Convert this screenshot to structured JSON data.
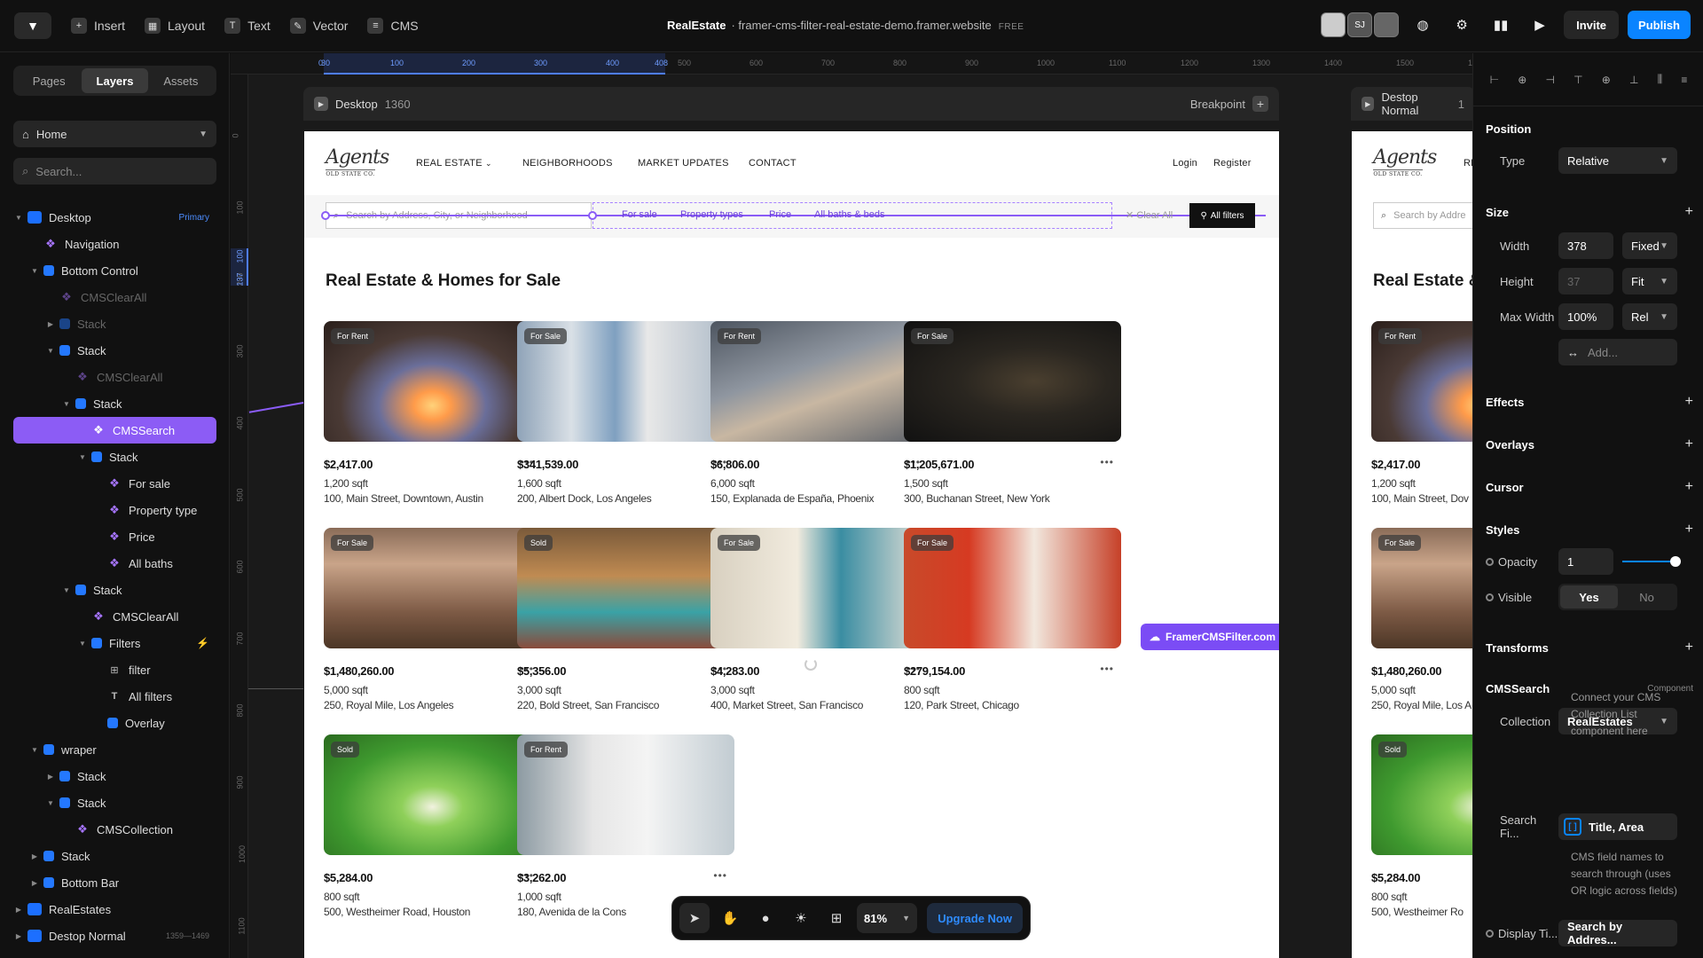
{
  "topbar": {
    "tools": [
      "Insert",
      "Layout",
      "Text",
      "Vector",
      "CMS"
    ],
    "project_name": "RealEstate",
    "project_url": "· framer-cms-filter-real-estate-demo.framer.website",
    "plan": "FREE",
    "avatar_initials": "SJ",
    "invite": "Invite",
    "publish": "Publish"
  },
  "left": {
    "tabs": [
      "Pages",
      "Layers",
      "Assets"
    ],
    "active_tab": "Layers",
    "page": "Home",
    "search_placeholder": "Search...",
    "layers": [
      {
        "label": "Desktop",
        "icon": "frame",
        "depth": 0,
        "tag": "Primary",
        "twisty": "open"
      },
      {
        "label": "Navigation",
        "icon": "component",
        "depth": 1
      },
      {
        "label": "Bottom Control",
        "icon": "stack",
        "depth": 1,
        "twisty": "open"
      },
      {
        "label": "CMSClearAll",
        "icon": "component",
        "depth": 2,
        "dim": true
      },
      {
        "label": "Stack",
        "icon": "stack",
        "depth": 2,
        "dim": true,
        "twisty": "closed"
      },
      {
        "label": "Stack",
        "icon": "stack",
        "depth": 2,
        "twisty": "open"
      },
      {
        "label": "CMSClearAll",
        "icon": "component",
        "depth": 3,
        "dim": true
      },
      {
        "label": "Stack",
        "icon": "stack",
        "depth": 3,
        "twisty": "open"
      },
      {
        "label": "CMSSearch",
        "icon": "component",
        "depth": 4,
        "selected": true
      },
      {
        "label": "Stack",
        "icon": "stack",
        "depth": 4,
        "twisty": "open"
      },
      {
        "label": "For sale",
        "icon": "component",
        "depth": 5
      },
      {
        "label": "Property type",
        "icon": "component",
        "depth": 5
      },
      {
        "label": "Price",
        "icon": "component",
        "depth": 5
      },
      {
        "label": "All baths",
        "icon": "component",
        "depth": 5
      },
      {
        "label": "Stack",
        "icon": "stack",
        "depth": 3,
        "twisty": "open"
      },
      {
        "label": "CMSClearAll",
        "icon": "component",
        "depth": 4
      },
      {
        "label": "Filters",
        "icon": "stack",
        "depth": 4,
        "twisty": "open",
        "bolt": true
      },
      {
        "label": "filter",
        "icon": "grid",
        "depth": 5
      },
      {
        "label": "All filters",
        "icon": "text",
        "depth": 5
      },
      {
        "label": "Overlay",
        "icon": "stack",
        "depth": 5
      },
      {
        "label": "wraper",
        "icon": "stack",
        "depth": 1,
        "twisty": "open"
      },
      {
        "label": "Stack",
        "icon": "stack",
        "depth": 2,
        "twisty": "closed"
      },
      {
        "label": "Stack",
        "icon": "stack",
        "depth": 2,
        "twisty": "open"
      },
      {
        "label": "CMSCollection",
        "icon": "component",
        "depth": 3
      },
      {
        "label": "Stack",
        "icon": "stack",
        "depth": 1,
        "twisty": "closed"
      },
      {
        "label": "Bottom Bar",
        "icon": "stack",
        "depth": 1,
        "twisty": "closed"
      },
      {
        "label": "RealEstates",
        "icon": "frame",
        "depth": 0,
        "twisty": "closed"
      },
      {
        "label": "Destop Normal",
        "icon": "frame",
        "depth": 0,
        "twisty": "closed",
        "dims": "1359—1469"
      }
    ]
  },
  "canvas": {
    "ruler_h": [
      "0",
      "100",
      "200",
      "300",
      "400",
      "500",
      "600",
      "700",
      "800",
      "900",
      "1000",
      "1100",
      "1200",
      "1300",
      "1400",
      "1500",
      "1600"
    ],
    "ruler_h_start": "30",
    "ruler_h_end": "408",
    "ruler_v": [
      "0",
      "100",
      "200",
      "300",
      "400",
      "500",
      "600",
      "700",
      "800",
      "900",
      "1000",
      "1100"
    ],
    "ruler_v_sel": [
      "100",
      "137"
    ],
    "frame1": {
      "name": "Desktop",
      "width": "1360",
      "breakpoint": "Breakpoint"
    },
    "frame2": {
      "name": "Destop Normal",
      "width": "1"
    },
    "site": {
      "logo": "Agents",
      "logo_sub": "OLD STATE CO.",
      "nav": [
        "REAL ESTATE",
        "NEIGHBORHOODS",
        "MARKET UPDATES",
        "CONTACT"
      ],
      "login": "Login",
      "register": "Register",
      "search_placeholder": "Search by Address, City, or Neighborhood",
      "filters": [
        "For sale",
        "Property types",
        "Price",
        "All baths & beds"
      ],
      "clear_all": "Clear All",
      "all_filters": "All filters",
      "heading": "Real Estate & Homes for Sale",
      "heading_partial": "Real Estate &",
      "float_label": "FramerCMSFilter.com",
      "listings": [
        {
          "badge": "For Rent",
          "price": "$2,417.00",
          "sqft": "1,200 sqft",
          "addr": "100, Main Street, Downtown, Austin"
        },
        {
          "badge": "For Sale",
          "price": "$341,539.00",
          "sqft": "1,600 sqft",
          "addr": "200, Albert Dock, Los Angeles"
        },
        {
          "badge": "For Rent",
          "price": "$6,806.00",
          "sqft": "6,000 sqft",
          "addr": "150, Explanada de España, Phoenix"
        },
        {
          "badge": "For Sale",
          "price": "$1,205,671.00",
          "sqft": "1,500 sqft",
          "addr": "300, Buchanan Street, New York"
        },
        {
          "badge": "For Sale",
          "price": "$1,480,260.00",
          "sqft": "5,000 sqft",
          "addr": "250, Royal Mile, Los Angeles"
        },
        {
          "badge": "Sold",
          "price": "$5,356.00",
          "sqft": "3,000 sqft",
          "addr": "220, Bold Street, San Francisco"
        },
        {
          "badge": "For Sale",
          "price": "$4,283.00",
          "sqft": "3,000 sqft",
          "addr": "400, Market Street, San Francisco"
        },
        {
          "badge": "For Sale",
          "price": "$279,154.00",
          "sqft": "800 sqft",
          "addr": "120, Park Street, Chicago"
        },
        {
          "badge": "Sold",
          "price": "$5,284.00",
          "sqft": "800 sqft",
          "addr": "500, Westheimer Road, Houston"
        },
        {
          "badge": "For Rent",
          "price": "$3,262.00",
          "sqft": "1,000 sqft",
          "addr": "180, Avenida de la Cons"
        }
      ],
      "preview2": {
        "search_placeholder": "Search by Addre",
        "listings": [
          {
            "badge": "For Rent",
            "price": "$2,417.00",
            "sqft": "1,200 sqft",
            "addr": "100, Main Street, Dov"
          },
          {
            "badge": "For Sale",
            "price": "$1,480,260.00",
            "sqft": "5,000 sqft",
            "addr": "250, Royal Mile, Los A"
          },
          {
            "badge": "Sold",
            "price": "$5,284.00",
            "sqft": "800 sqft",
            "addr": "500, Westheimer Ro"
          }
        ]
      }
    },
    "toolbar": {
      "zoom": "81%",
      "upgrade": "Upgrade Now"
    }
  },
  "right": {
    "position": {
      "title": "Position",
      "type_label": "Type",
      "type_value": "Relative"
    },
    "size": {
      "title": "Size",
      "width_label": "Width",
      "width_value": "378",
      "width_mode": "Fixed",
      "height_label": "Height",
      "height_value": "37",
      "height_mode": "Fit",
      "maxw_label": "Max Width",
      "maxw_value": "100%",
      "maxw_mode": "Rel",
      "add": "Add..."
    },
    "sections": [
      "Effects",
      "Overlays",
      "Cursor",
      "Styles"
    ],
    "opacity_label": "Opacity",
    "opacity_value": "1",
    "visible_label": "Visible",
    "visible_yes": "Yes",
    "visible_no": "No",
    "transforms": "Transforms",
    "component_title": "CMSSearch",
    "component_tag": "Component",
    "collection_label": "Collection",
    "collection_value": "RealEstates",
    "collection_help": "Connect your CMS Collection List component here",
    "search_fields_label": "Search Fi...",
    "search_fields_value": "Title, Area",
    "search_fields_help": "CMS field names to search through (uses OR logic across fields)",
    "display_label": "Display Ti...",
    "display_value": "Search by Addres..."
  }
}
